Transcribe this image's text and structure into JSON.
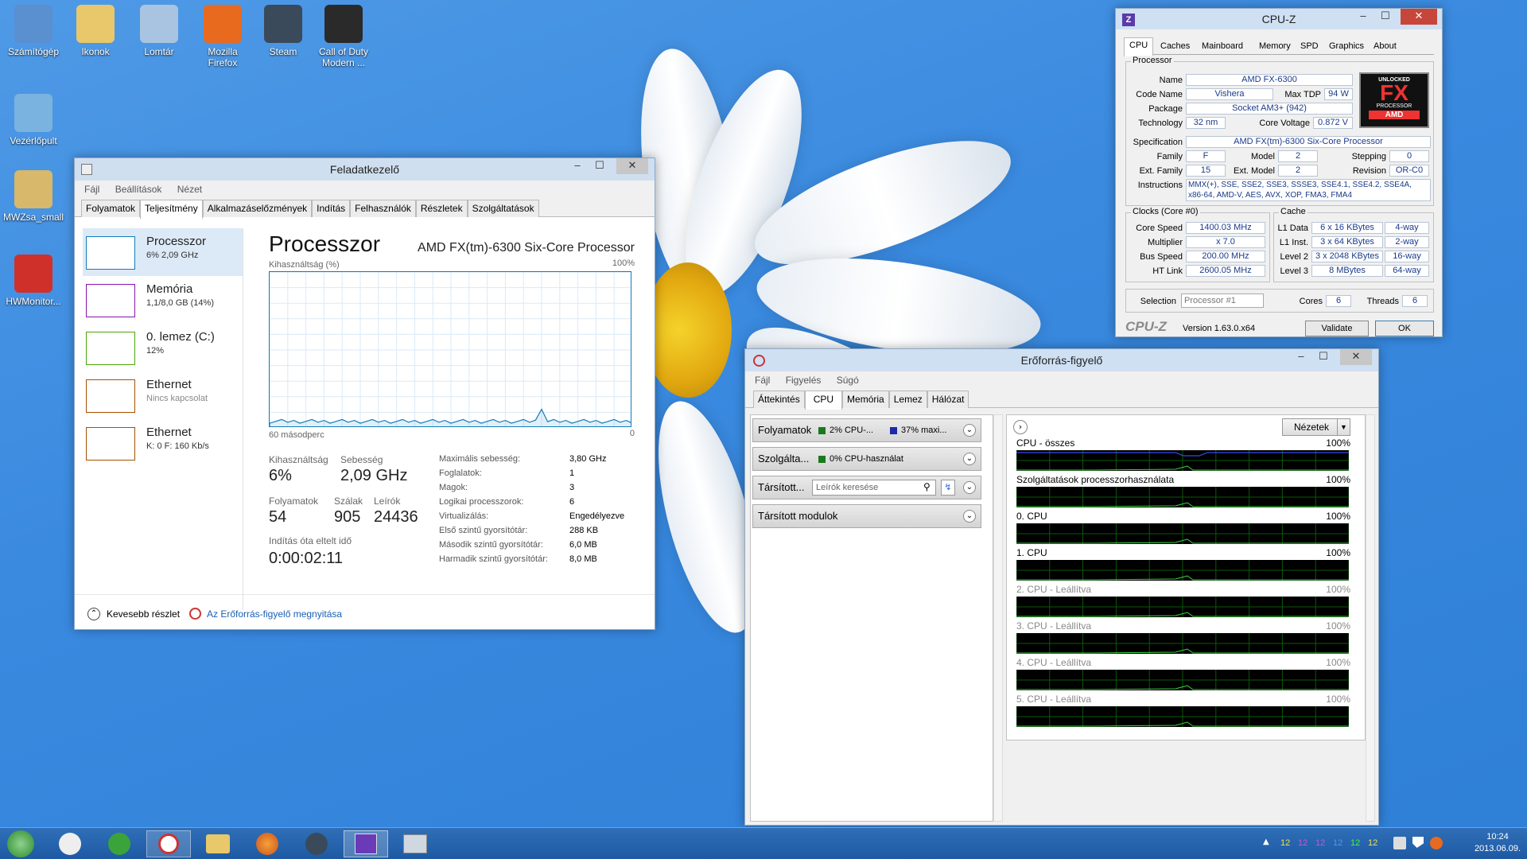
{
  "desktop": {
    "icons": [
      {
        "label": "Számítógép",
        "color": "#5a8fd0"
      },
      {
        "label": "Ikonok",
        "color": "#e8c86a"
      },
      {
        "label": "Lomtár",
        "color": "#a9c4e0"
      },
      {
        "label": "Mozilla Firefox",
        "color": "#e86a1f"
      },
      {
        "label": "Steam",
        "color": "#3a4a5a"
      },
      {
        "label": "Call of Duty Modern ...",
        "color": "#2a2a2a"
      },
      {
        "label": "Vezérlőpult",
        "color": "#7ab3e0"
      },
      {
        "label": "MWZsa_small",
        "color": "#d8b86a"
      },
      {
        "label": "HWMonitor...",
        "color": "#d0302a"
      }
    ]
  },
  "taskmgr": {
    "title": "Feladatkezelő",
    "menu": [
      "Fájl",
      "Beállítások",
      "Nézet"
    ],
    "tabs": [
      "Folyamatok",
      "Teljesítmény",
      "Alkalmazáselőzmények",
      "Indítás",
      "Felhasználók",
      "Részletek",
      "Szolgáltatások"
    ],
    "side": [
      {
        "name": "Processzor",
        "sub": "6% 2,09 GHz",
        "color": "#117dbb"
      },
      {
        "name": "Memória",
        "sub": "1,1/8,0 GB (14%)",
        "color": "#8b12ae"
      },
      {
        "name": "0. lemez (C:)",
        "sub": "12%",
        "color": "#4da60c"
      },
      {
        "name": "Ethernet",
        "sub": "Nincs kapcsolat",
        "color": "#a74f01"
      },
      {
        "name": "Ethernet",
        "sub": "K: 0 F: 160 Kb/s",
        "color": "#a74f01"
      }
    ],
    "heading": "Processzor",
    "cpu_name": "AMD FX(tm)-6300 Six-Core Processor",
    "util_label": "Kihasználtság (%)",
    "pct100": "100%",
    "seconds": "60 másodperc",
    "zero": "0",
    "stats": {
      "util_l": "Kihasználtság",
      "util_v": "6%",
      "speed_l": "Sebesség",
      "speed_v": "2,09 GHz",
      "proc_l": "Folyamatok",
      "proc_v": "54",
      "thr_l": "Szálak",
      "thr_v": "905",
      "hnd_l": "Leírók",
      "hnd_v": "24436",
      "up_l": "Indítás óta eltelt idő",
      "up_v": "0:00:02:11"
    },
    "details": [
      [
        "Maximális sebesség:",
        "3,80 GHz"
      ],
      [
        "Foglalatok:",
        "1"
      ],
      [
        "Magok:",
        "3"
      ],
      [
        "Logikai processzorok:",
        "6"
      ],
      [
        "Virtualizálás:",
        "Engedélyezve"
      ],
      [
        "Első szintű gyorsítótár:",
        "288 KB"
      ],
      [
        "Második szintű gyorsítótár:",
        "6,0 MB"
      ],
      [
        "Harmadik szintű gyorsítótár:",
        "8,0 MB"
      ]
    ],
    "fewer": "Kevesebb részlet",
    "open_resmon": "Az Erőforrás-figyelő megnyitása"
  },
  "cpuz": {
    "title": "CPU-Z",
    "tabs": [
      "CPU",
      "Caches",
      "Mainboard",
      "Memory",
      "SPD",
      "Graphics",
      "About"
    ],
    "processor_group": "Processor",
    "name_l": "Name",
    "name_v": "AMD FX-6300",
    "code_l": "Code Name",
    "code_v": "Vishera",
    "tdp_l": "Max TDP",
    "tdp_v": "94 W",
    "pkg_l": "Package",
    "pkg_v": "Socket AM3+ (942)",
    "tech_l": "Technology",
    "tech_v": "32 nm",
    "volt_l": "Core Voltage",
    "volt_v": "0.872 V",
    "spec_l": "Specification",
    "spec_v": "AMD FX(tm)-6300 Six-Core Processor",
    "fam_l": "Family",
    "fam_v": "F",
    "mod_l": "Model",
    "mod_v": "2",
    "step_l": "Stepping",
    "step_v": "0",
    "efam_l": "Ext. Family",
    "efam_v": "15",
    "emod_l": "Ext. Model",
    "emod_v": "2",
    "rev_l": "Revision",
    "rev_v": "OR-C0",
    "instr_l": "Instructions",
    "instr_v1": "MMX(+), SSE, SSE2, SSE3, SSSE3, SSE4.1, SSE4.2, SSE4A,",
    "instr_v2": "x86-64, AMD-V, AES, AVX, XOP, FMA3, FMA4",
    "clocks_group": "Clocks (Core #0)",
    "cs_l": "Core Speed",
    "cs_v": "1400.03 MHz",
    "mul_l": "Multiplier",
    "mul_v": "x 7.0",
    "bus_l": "Bus Speed",
    "bus_v": "200.00 MHz",
    "ht_l": "HT Link",
    "ht_v": "2600.05 MHz",
    "cache_group": "Cache",
    "l1d_l": "L1 Data",
    "l1d_v": "6 x 16 KBytes",
    "l1d_w": "4-way",
    "l1i_l": "L1 Inst.",
    "l1i_v": "3 x 64 KBytes",
    "l1i_w": "2-way",
    "l2_l": "Level 2",
    "l2_v": "3 x 2048 KBytes",
    "l2_w": "16-way",
    "l3_l": "Level 3",
    "l3_v": "8 MBytes",
    "l3_w": "64-way",
    "sel_l": "Selection",
    "sel_v": "Processor #1",
    "cores_l": "Cores",
    "cores_v": "6",
    "threads_l": "Threads",
    "threads_v": "6",
    "brand": "CPU-Z",
    "version": "Version 1.63.0.x64",
    "validate": "Validate",
    "ok": "OK",
    "logo_top": "UNLOCKED",
    "logo_fx": "FX",
    "logo_proc": "PROCESSOR",
    "logo_amd": "AMD"
  },
  "resmon": {
    "title": "Erőforrás-figyelő",
    "menu": [
      "Fájl",
      "Figyelés",
      "Súgó"
    ],
    "tabs": [
      "Áttekintés",
      "CPU",
      "Memória",
      "Lemez",
      "Hálózat"
    ],
    "sec1": "Folyamatok",
    "sec1_a": "2% CPU-...",
    "sec1_b": "37% maxi...",
    "sec2": "Szolgálta...",
    "sec2_a": "0% CPU-használat",
    "sec3": "Társított...",
    "search_ph": "Leírók keresése",
    "sec4": "Társított modulok",
    "views": "Nézetek",
    "graphs": [
      {
        "name": "CPU - összes",
        "pct": "100%"
      },
      {
        "name": "Szolgáltatások processzorhasználata",
        "pct": "100%"
      },
      {
        "name": "0. CPU",
        "pct": "100%"
      },
      {
        "name": "1. CPU",
        "pct": "100%"
      },
      {
        "name": "2. CPU - Leállítva",
        "pct": "100%"
      },
      {
        "name": "3. CPU - Leállítva",
        "pct": "100%"
      },
      {
        "name": "4. CPU - Leállítva",
        "pct": "100%"
      },
      {
        "name": "5. CPU - Leállítva",
        "pct": "100%"
      }
    ]
  },
  "taskbar": {
    "time": "10:24",
    "date": "2013.06.09.",
    "tray_nums": [
      "12",
      "12",
      "12",
      "12",
      "12",
      "12"
    ]
  }
}
